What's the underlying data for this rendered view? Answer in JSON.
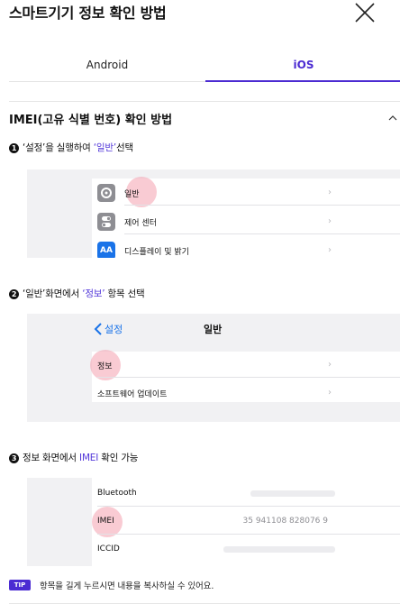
{
  "header": {
    "title": "스마트기기 정보 확인 방법",
    "close_icon": "close-icon"
  },
  "tabs": [
    {
      "label": "Android",
      "active": false
    },
    {
      "label": "iOS",
      "active": true
    }
  ],
  "section": {
    "title": "IMEI(고유 식별 번호) 확인 방법",
    "toggle_icon": "chevron-up-icon"
  },
  "steps": [
    {
      "number": "1",
      "text_before": "‘설정’을 실행하여 ",
      "highlight": "‘일반’",
      "text_after": "선택",
      "screenshot": {
        "rows": [
          {
            "icon": "gear-icon",
            "label": "일반"
          },
          {
            "icon": "toggle-icon",
            "label": "제어 센터"
          },
          {
            "icon": "text-size-icon",
            "icon_text": "AA",
            "label": "디스플레이 및 밝기"
          }
        ]
      }
    },
    {
      "number": "2",
      "text_before": "‘일반’화면에서 ",
      "highlight": "‘정보’",
      "text_after": " 항목 선택",
      "screenshot": {
        "nav_back": "설정",
        "nav_title": "일반",
        "rows": [
          {
            "label": "정보"
          },
          {
            "label": "소프트웨어 업데이트"
          }
        ]
      }
    },
    {
      "number": "3",
      "text_before": "정보 화면에서 ",
      "highlight": "IMEI",
      "text_after": " 확인 가능",
      "screenshot": {
        "rows": [
          {
            "label": "Bluetooth",
            "value": ""
          },
          {
            "label": "IMEI",
            "value": "35 941108 828076 9"
          },
          {
            "label": "ICCID",
            "value": ""
          }
        ]
      }
    }
  ],
  "tip": {
    "badge": "TIP",
    "text": "항목을 길게 누르시면 내용을 복사하실 수 있어요."
  },
  "colors": {
    "accent": "#4b2bd2",
    "highlight_text": "#5237d9",
    "screenshot_bg": "#f1f1f3",
    "touch_marker": "#f4a0af"
  }
}
